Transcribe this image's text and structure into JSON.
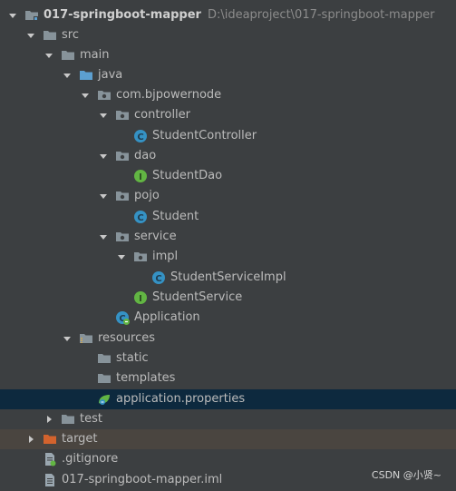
{
  "tree": {
    "root": {
      "name": "017-springboot-mapper",
      "path": "D:\\ideaproject\\017-springboot-mapper"
    },
    "src": "src",
    "main": "main",
    "java": "java",
    "package": "com.bjpowernode",
    "controller": "controller",
    "student_controller": "StudentController",
    "dao": "dao",
    "student_dao": "StudentDao",
    "pojo": "pojo",
    "student": "Student",
    "service": "service",
    "impl": "impl",
    "student_service_impl": "StudentServiceImpl",
    "student_service": "StudentService",
    "application": "Application",
    "resources": "resources",
    "static": "static",
    "templates": "templates",
    "application_properties": "application.properties",
    "test": "test",
    "target": "target",
    "gitignore": ".gitignore",
    "iml": "017-springboot-mapper.iml"
  },
  "watermark": "CSDN @小贤~",
  "colors": {
    "background": "#3c3f41",
    "selection": "#0d293e",
    "excluded_row": "#4a4540",
    "folder": "#87939a",
    "source_folder": "#5c9fd0",
    "class_icon": "#3592c4",
    "interface_icon": "#62b543",
    "excluded_folder": "#d4632d"
  }
}
